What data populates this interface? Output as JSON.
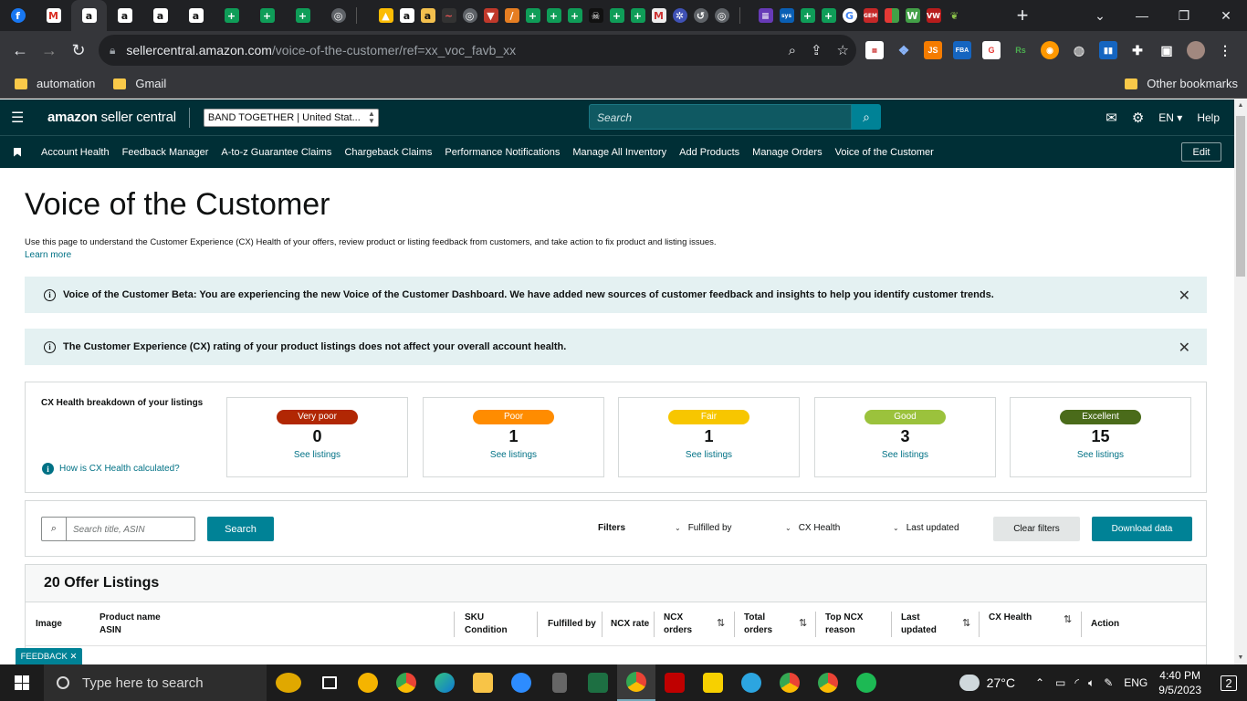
{
  "browser": {
    "url_host": "sellercentral.amazon.com",
    "url_path": "/voice-of-the-customer/ref=xx_voc_favb_xx",
    "bookmarks": [
      "automation",
      "Gmail"
    ],
    "other_bookmarks": "Other bookmarks"
  },
  "header": {
    "logo_brand": "amazon",
    "logo_product": " seller central",
    "store": "BAND TOGETHER | United Stat...",
    "search_placeholder": "Search",
    "language": "EN",
    "help": "Help"
  },
  "nav": {
    "links": [
      "Account Health",
      "Feedback Manager",
      "A-to-z Guarantee Claims",
      "Chargeback Claims",
      "Performance Notifications",
      "Manage All Inventory",
      "Add Products",
      "Manage Orders",
      "Voice of the Customer"
    ],
    "edit": "Edit"
  },
  "page": {
    "title": "Voice of the Customer",
    "description": "Use this page to understand the Customer Experience (CX) Health of your offers, review product or listing feedback from customers, and take action to fix product and listing issues.",
    "learn_more": "Learn more",
    "alert1": "Voice of the Customer Beta: You are experiencing the new Voice of the Customer Dashboard. We have added new sources of customer feedback and insights to help you identify customer trends.",
    "alert2": "The Customer Experience (CX) rating of your product listings does not affect your overall account health."
  },
  "cx": {
    "label": "CX Health breakdown of your listings",
    "help_link": "How is CX Health calculated?",
    "see_listings": "See listings",
    "cards": [
      {
        "rating": "Very poor",
        "count": "0",
        "color": "#b12704"
      },
      {
        "rating": "Poor",
        "count": "1",
        "color": "#ff8c00"
      },
      {
        "rating": "Fair",
        "count": "1",
        "color": "#f7c600"
      },
      {
        "rating": "Good",
        "count": "3",
        "color": "#9bc23c"
      },
      {
        "rating": "Excellent",
        "count": "15",
        "color": "#4a6b1a"
      }
    ]
  },
  "filters": {
    "search_placeholder": "Search title, ASIN",
    "search_button": "Search",
    "label": "Filters",
    "fulfilled_by": "Fulfilled by",
    "cx_health": "CX Health",
    "last_updated": "Last updated",
    "clear": "Clear filters",
    "download": "Download data"
  },
  "table": {
    "title": "20 Offer Listings",
    "columns": {
      "image": "Image",
      "product_name": "Product name",
      "asin": "ASIN",
      "sku": "SKU",
      "condition": "Condition",
      "fulfilled_by": "Fulfilled by",
      "ncx_rate": "NCX rate",
      "ncx": "NCX",
      "orders": "orders",
      "total": "Total",
      "top_ncx": "Top NCX",
      "reason": "reason",
      "last": "Last",
      "updated": "updated",
      "cx_health": "CX Health",
      "action": "Action"
    }
  },
  "feedback": "FEEDBACK",
  "taskbar": {
    "search_placeholder": "Type here to search",
    "weather": "27°C",
    "language": "ENG",
    "time": "4:40 PM",
    "date": "9/5/2023",
    "notifications": "2"
  }
}
